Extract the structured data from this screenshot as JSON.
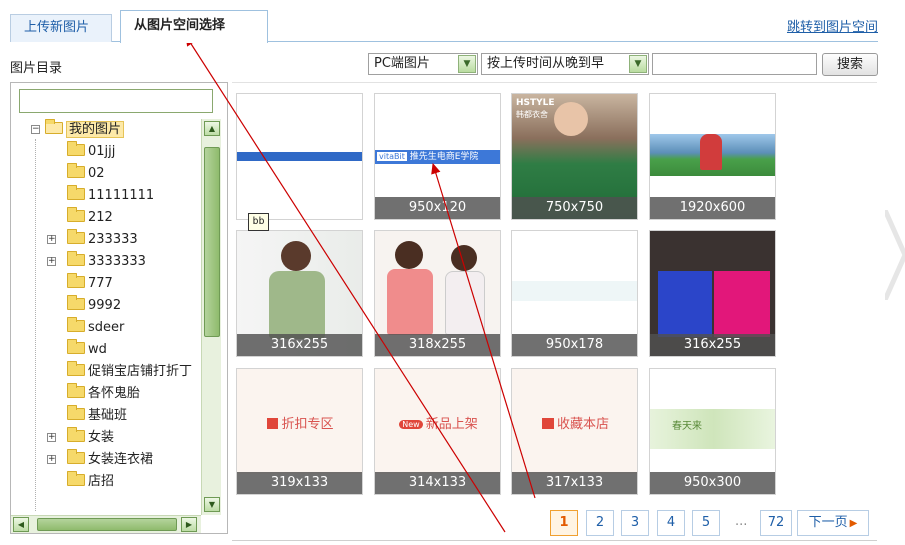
{
  "tabs": {
    "upload": "上传新图片",
    "space": "从图片空间选择"
  },
  "jump_link": "跳转到图片空间",
  "directory_label": "图片目录",
  "filters": {
    "source": "PC端图片",
    "sort": "按上传时间从晚到早",
    "search_button": "搜索"
  },
  "tree": {
    "root": "我的图片",
    "items": [
      {
        "label": "01jjj",
        "expandable": false
      },
      {
        "label": "02",
        "expandable": false
      },
      {
        "label": "11111111",
        "expandable": false
      },
      {
        "label": "212",
        "expandable": false
      },
      {
        "label": "233333",
        "expandable": true
      },
      {
        "label": "3333333",
        "expandable": true
      },
      {
        "label": "777",
        "expandable": false
      },
      {
        "label": "9992",
        "expandable": false
      },
      {
        "label": "sdeer",
        "expandable": false
      },
      {
        "label": "wd",
        "expandable": false
      },
      {
        "label": "促销宝店铺打折丁",
        "expandable": false
      },
      {
        "label": "各怀鬼胎",
        "expandable": false
      },
      {
        "label": "基础班",
        "expandable": false
      },
      {
        "label": "女装",
        "expandable": true
      },
      {
        "label": "女装连衣裙",
        "expandable": true
      },
      {
        "label": "店招",
        "expandable": false
      }
    ]
  },
  "tooltip": "bb",
  "images": [
    {
      "size": "",
      "banner": "",
      "kind": "banner-blue"
    },
    {
      "size": "950x120",
      "banner": "推先生电商E学院",
      "badge": "vitaBit",
      "kind": "banner-text"
    },
    {
      "size": "750x750",
      "label": "HSTYLE",
      "sublabel": "韩都衣舍",
      "kind": "dress-green"
    },
    {
      "size": "1920x600",
      "kind": "stadium"
    },
    {
      "size": "316x255",
      "kind": "model-green"
    },
    {
      "size": "318x255",
      "kind": "model-pink"
    },
    {
      "size": "950x178",
      "kind": "banner-pale"
    },
    {
      "size": "316x255",
      "kind": "model-blue"
    },
    {
      "size": "319x133",
      "banner": "折扣专区",
      "kind": "tag-discount"
    },
    {
      "size": "314x133",
      "banner": "新品上架",
      "badge": "New",
      "kind": "tag-new"
    },
    {
      "size": "317x133",
      "banner": "收藏本店",
      "kind": "tag-fav"
    },
    {
      "size": "950x300",
      "banner": "春天来",
      "kind": "spring"
    }
  ],
  "pagination": {
    "pages": [
      "1",
      "2",
      "3",
      "4",
      "5"
    ],
    "ellipsis": "...",
    "last": "72",
    "next": "下一页",
    "current": "1"
  },
  "colors": {
    "link": "#1f5fa8",
    "active_page": "#e25a00",
    "scroll_green": "#8fbb6d",
    "arrow": "#cc0000"
  }
}
